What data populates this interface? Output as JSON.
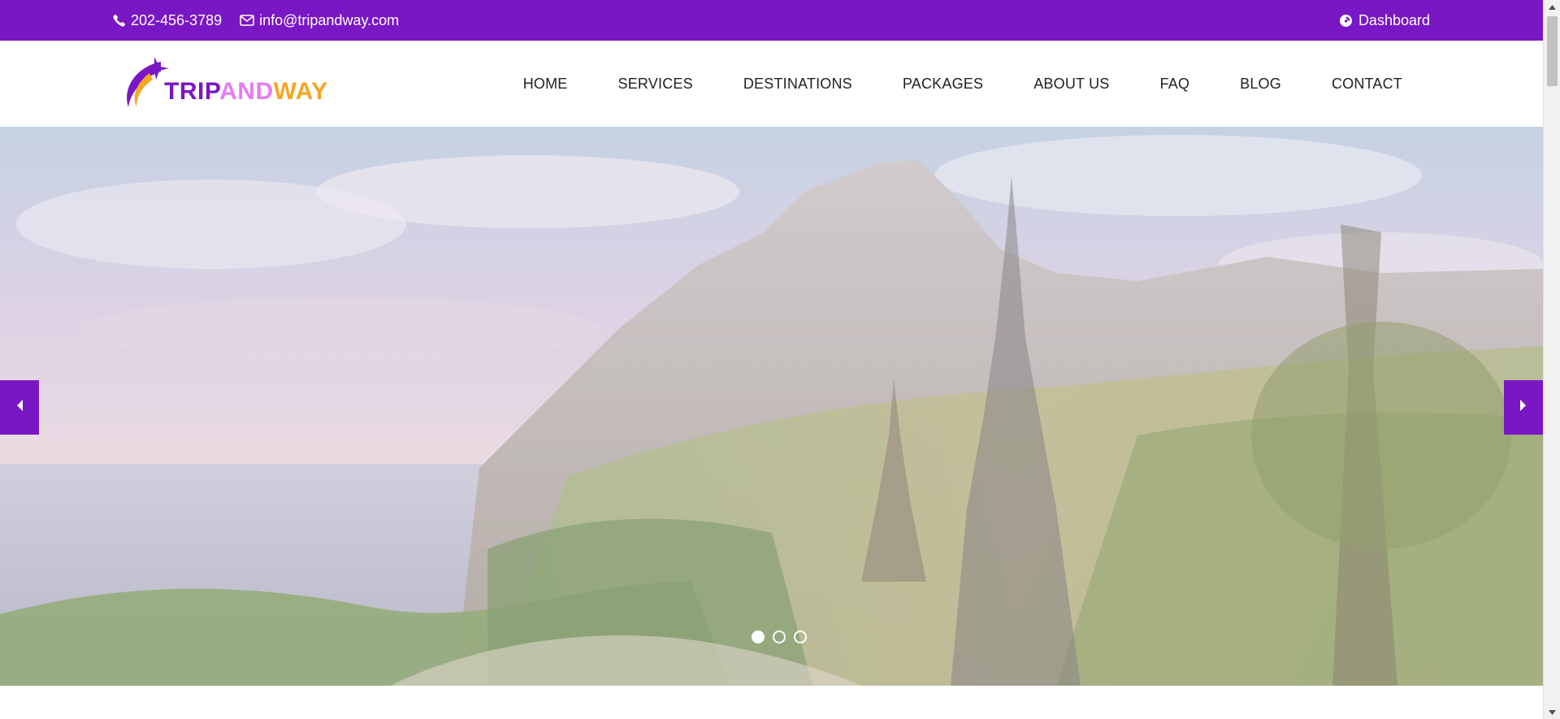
{
  "topbar": {
    "phone": "202-456-3789",
    "email": "info@tripandway.com",
    "dashboard_label": "Dashboard",
    "background": "#7a17c4"
  },
  "brand": {
    "logo_part1": "TRIP",
    "logo_part2": "AND",
    "logo_part3": "WAY",
    "colors": {
      "purple": "#7a17c4",
      "pink": "#e57cf0",
      "orange": "#f5a623"
    }
  },
  "nav": {
    "items": [
      "HOME",
      "SERVICES",
      "DESTINATIONS",
      "PACKAGES",
      "ABOUT US",
      "FAQ",
      "BLOG",
      "CONTACT"
    ]
  },
  "slider": {
    "slide_count": 3,
    "active_index": 0,
    "arrow_color": "#7a17c4"
  },
  "icons": {
    "phone": "phone-icon",
    "email": "envelope-icon",
    "dashboard": "dashboard-icon",
    "prev": "caret-left-icon",
    "next": "caret-right-icon"
  }
}
